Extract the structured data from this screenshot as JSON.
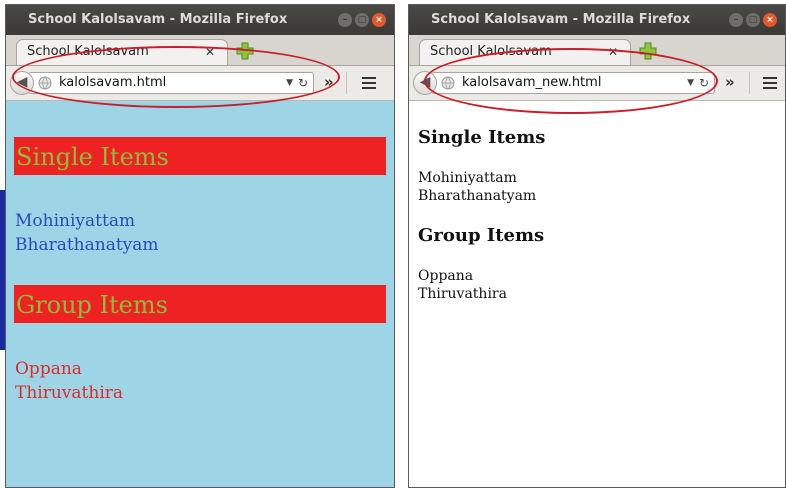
{
  "left_window": {
    "title": "School Kalolsavam - Mozilla Firefox",
    "tab_label": "School Kalolsavam",
    "url": "kalolsavam.html",
    "content": {
      "heading_1": "Single Items",
      "items_1": [
        "Mohiniyattam",
        "Bharathanatyam"
      ],
      "heading_2": "Group Items",
      "items_2": [
        "Oppana",
        "Thiruvathira"
      ]
    }
  },
  "right_window": {
    "title": "School Kalolsavam - Mozilla Firefox",
    "tab_label": "School Kalolsavam",
    "url": "kalolsavam_new.html",
    "content": {
      "heading_1": "Single Items",
      "items_1": [
        "Mohiniyattam",
        "Bharathanatyam"
      ],
      "heading_2": "Group Items",
      "items_2": [
        "Oppana",
        "Thiruvathira"
      ]
    }
  },
  "colors": {
    "left_background": "#9dd5e6",
    "heading_banner": "#ee2222",
    "heading_text": "#8bbf3a",
    "single_items_text": "#2a4ab8",
    "group_items_text": "#dd2a2a",
    "annotation_ellipse": "#c8202a"
  },
  "icons": {
    "tab_close": "close-icon",
    "new_tab": "plus-icon",
    "back": "back-arrow-icon",
    "site_identity": "globe-icon",
    "url_dropdown": "dropdown-arrow-icon",
    "reload": "reload-icon",
    "overflow": "chevron-double-right-icon",
    "menu": "hamburger-menu-icon"
  }
}
